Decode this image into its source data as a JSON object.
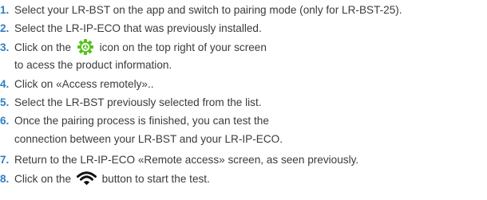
{
  "colors": {
    "number": "#2f7fc1",
    "text": "#3b3b3b",
    "gear_icon": "#53c21a",
    "wifi_icon": "#111111"
  },
  "steps": [
    {
      "num": "1.",
      "text": "Select your LR-BST on the app and switch to pairing mode (only for LR-BST-25)."
    },
    {
      "num": "2.",
      "text": "Select the LR-IP-ECO that was previously installed."
    },
    {
      "num": "3.",
      "text_before": "Click on the",
      "icon": "gear-icon",
      "text_after": "icon on the top right of your screen",
      "text_cont": "to acess the product information."
    },
    {
      "num": "4.",
      "text": "Click on «Access remotely».."
    },
    {
      "num": "5.",
      "text": "Select the LR-BST previously selected from the list."
    },
    {
      "num": "6.",
      "text": "Once the pairing process is finished, you can test the",
      "text_cont": "connection between your LR-BST and your LR-IP-ECO."
    },
    {
      "num": "7.",
      "text": "Return to the LR-IP-ECO «Remote access» screen, as seen previously."
    },
    {
      "num": "8.",
      "text_before": "Click on the",
      "icon": "wifi-icon",
      "text_after": "button to start the test."
    }
  ]
}
